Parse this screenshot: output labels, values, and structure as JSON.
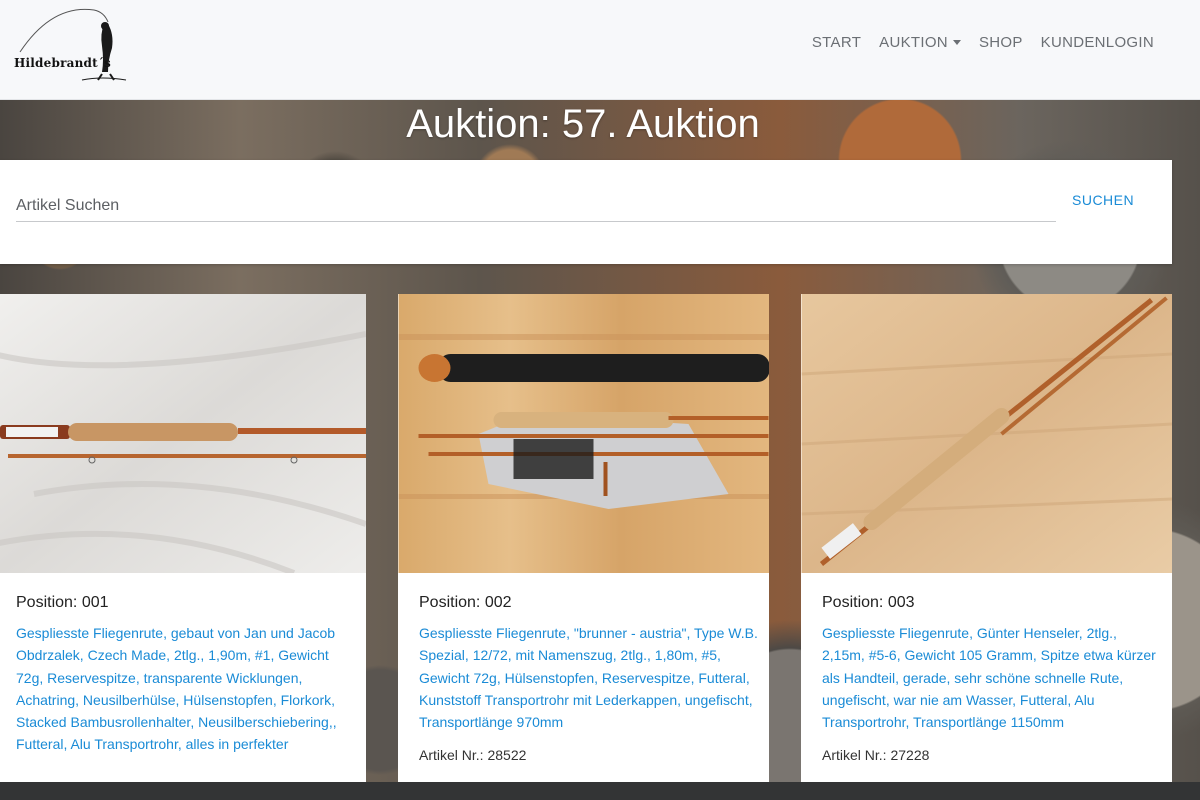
{
  "brand": {
    "logo_text": "Hildebrandt´s"
  },
  "nav": {
    "items": [
      {
        "label": "START"
      },
      {
        "label": "AUKTION"
      },
      {
        "label": "SHOP"
      },
      {
        "label": "KUNDENLOGIN"
      }
    ]
  },
  "hero": {
    "title": "Auktion: 57. Auktion"
  },
  "search": {
    "placeholder": "Artikel Suchen",
    "button_label": "SUCHEN"
  },
  "cards": [
    {
      "position": "Position: 001",
      "description": "Gespliesste Fliegenrute, gebaut von Jan und Jacob Obdrzalek, Czech Made, 2tlg., 1,90m, #1, Gewicht 72g, Reservespitze, transparente Wicklungen, Achatring, Neusilberhülse, Hülsenstopfen, Florkork, Stacked Bambusrollenhalter, Neusilberschiebering,, Futteral, Alu Transportrohr, alles in perfekter",
      "article_nr": ""
    },
    {
      "position": "Position: 002",
      "description": "Gespliesste Fliegenrute, \"brunner - austria\", Type W.B. Spezial, 12/72, mit Namenszug, 2tlg., 1,80m, #5, Gewicht 72g, Hülsenstopfen, Reservespitze, Futteral, Kunststoff Transportrohr mit Lederkappen, ungefischt, Transportlänge 970mm",
      "article_nr": "Artikel Nr.: 28522"
    },
    {
      "position": "Position: 003",
      "description": "Gespliesste Fliegenrute, Günter Henseler, 2tlg., 2,15m, #5-6, Gewicht 105 Gramm, Spitze etwa kürzer als Handteil, gerade, sehr schöne schnelle Rute, ungefischt, war nie am Wasser, Futteral, Alu Transportrohr, Transportlänge 1150mm",
      "article_nr": "Artikel Nr.: 27228"
    }
  ],
  "colors": {
    "link": "#1a8bd6",
    "navbar_bg": "#f7f8fa",
    "nav_text": "#6b6f74",
    "footer": "#333435"
  }
}
